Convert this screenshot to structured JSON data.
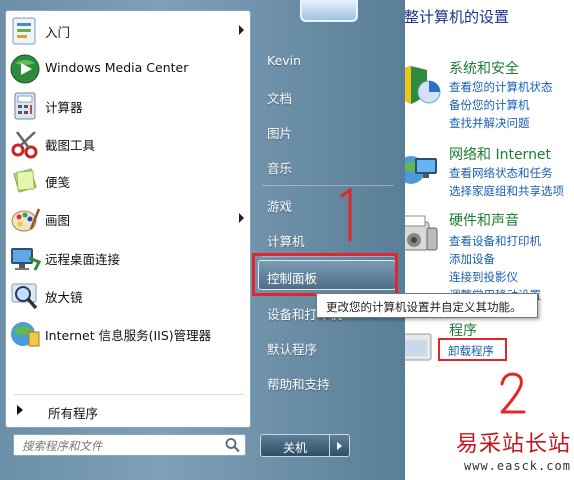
{
  "control_panel": {
    "title": "整计算机的设置",
    "categories": [
      {
        "heading": "系统和安全",
        "links": [
          "查看您的计算机状态",
          "备份您的计算机",
          "查找并解决问题"
        ],
        "icon": "shield-icon"
      },
      {
        "heading": "网络和 Internet",
        "links": [
          "查看网络状态和任务",
          "选择家庭组和共享选项"
        ],
        "icon": "network-icon"
      },
      {
        "heading": "硬件和声音",
        "links": [
          "查看设备和打印机",
          "添加设备",
          "连接到投影仪",
          "调整常用移动设置"
        ],
        "icon": "printer-icon"
      },
      {
        "heading": "程序",
        "links": [
          "卸载程序"
        ],
        "icon": "programs-icon"
      }
    ]
  },
  "start_menu": {
    "programs": [
      {
        "label": "入门",
        "icon": "getting-started-icon",
        "has_submenu": true
      },
      {
        "label": "Windows Media Center",
        "icon": "media-center-icon",
        "has_submenu": false
      },
      {
        "label": "计算器",
        "icon": "calculator-icon",
        "has_submenu": false
      },
      {
        "label": "截图工具",
        "icon": "snipping-tool-icon",
        "has_submenu": false
      },
      {
        "label": "便笺",
        "icon": "sticky-notes-icon",
        "has_submenu": false
      },
      {
        "label": "画图",
        "icon": "paint-icon",
        "has_submenu": true
      },
      {
        "label": "远程桌面连接",
        "icon": "remote-desktop-icon",
        "has_submenu": false
      },
      {
        "label": "放大镜",
        "icon": "magnifier-icon",
        "has_submenu": false
      },
      {
        "label": "Internet 信息服务(IIS)管理器",
        "icon": "iis-manager-icon",
        "has_submenu": false
      }
    ],
    "all_programs": "所有程序",
    "search_placeholder": "搜索程序和文件",
    "right_items": [
      "Kevin",
      "文档",
      "图片",
      "音乐",
      "游戏",
      "计算机",
      "控制面板",
      "设备和打印机",
      "默认程序",
      "帮助和支持"
    ],
    "highlighted_item": "控制面板",
    "tooltip": "更改您的计算机设置并自定义其功能。",
    "shutdown_label": "关机"
  },
  "annotations": {
    "step1": "1",
    "step2": "2",
    "highlight_color": "#e1262c"
  },
  "watermark": {
    "text": "易采站长站",
    "url": "www.easck.com"
  }
}
